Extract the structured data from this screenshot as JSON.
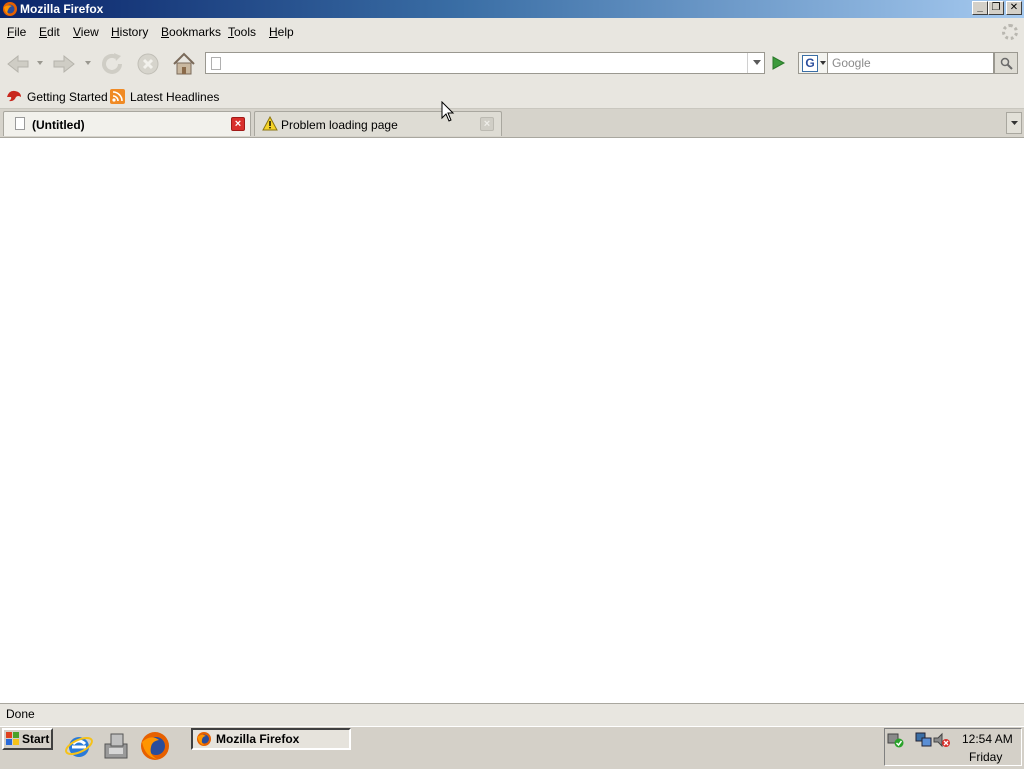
{
  "window": {
    "title": "Mozilla Firefox",
    "controls": {
      "minimize": "_",
      "restore": "❐",
      "close": "✕"
    }
  },
  "menubar": {
    "items": [
      {
        "label": "File",
        "key": "F",
        "rest": "ile"
      },
      {
        "label": "Edit",
        "key": "E",
        "rest": "dit"
      },
      {
        "label": "View",
        "key": "V",
        "rest": "iew"
      },
      {
        "label": "History",
        "key": "H",
        "rest": "istory"
      },
      {
        "label": "Bookmarks",
        "key": "B",
        "rest": "ookmarks"
      },
      {
        "label": "Tools",
        "key": "T",
        "rest": "ools"
      },
      {
        "label": "Help",
        "key": "H",
        "rest": "elp"
      }
    ]
  },
  "navbar": {
    "buttons": [
      "back-icon",
      "forward-icon",
      "reload-icon",
      "stop-icon",
      "home-icon"
    ],
    "url": {
      "value": "",
      "placeholder": ""
    },
    "search": {
      "engine": "G",
      "placeholder": "Google",
      "value": ""
    }
  },
  "bookmarks": [
    {
      "label": "Getting Started",
      "icon": "firefox-bookmark-icon"
    },
    {
      "label": "Latest Headlines",
      "icon": "rss-icon"
    }
  ],
  "tabs": [
    {
      "label": "(Untitled)",
      "active": true,
      "icon": "blank-page-icon"
    },
    {
      "label": "Problem loading page",
      "active": false,
      "icon": "warning-icon"
    }
  ],
  "status": {
    "text": "Done"
  },
  "taskbar": {
    "start_label": "Start",
    "quicklaunch": [
      "internet-explorer-icon",
      "show-desktop-icon",
      "firefox-icon"
    ],
    "tasks": [
      {
        "label": "Mozilla Firefox"
      }
    ],
    "clock": {
      "time": "12:54 AM",
      "day": "Friday"
    }
  },
  "colors": {
    "titlebar_start": "#0a246a",
    "titlebar_end": "#a6caf0",
    "chrome": "#e8e6e0",
    "tab_close_active": "#d9302c"
  }
}
